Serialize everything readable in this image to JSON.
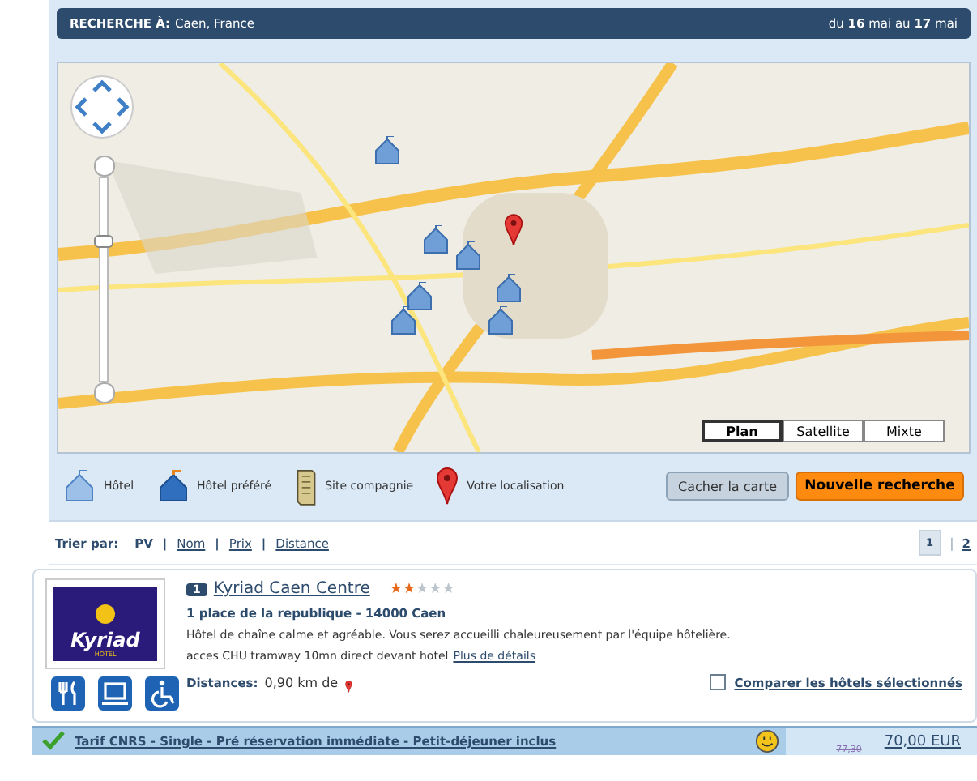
{
  "search_header": {
    "label": "RECHERCHE À:",
    "place": "Caen, France",
    "dates": "du **16** mai au **17** mai"
  },
  "map": {
    "zoom": {
      "level": 0.7
    },
    "map_types": [
      {
        "label": "Plan",
        "selected": true
      },
      {
        "label": "Satellite",
        "selected": false
      },
      {
        "label": "Mixte",
        "selected": false
      }
    ]
  },
  "legend": [
    {
      "kind": "hotel",
      "label": "Hôtel"
    },
    {
      "kind": "preferred",
      "label": "Hôtel préféré"
    },
    {
      "kind": "company",
      "label": "Site compagnie"
    },
    {
      "kind": "location",
      "label": "Votre localisation"
    }
  ],
  "buttons": {
    "hide_map": "Cacher la carte",
    "new_search": "Nouvelle recherche"
  },
  "sort": {
    "label": "Trier par:",
    "separator": "|",
    "options": [
      {
        "label": "PV",
        "selected": true
      },
      {
        "label": "Nom",
        "selected": false
      },
      {
        "label": "Prix",
        "selected": false
      },
      {
        "label": "Distance",
        "selected": false
      }
    ]
  },
  "pager": {
    "separator": "|",
    "pages": [
      {
        "label": "1",
        "selected": true
      },
      {
        "label": "2",
        "selected": false
      }
    ]
  },
  "hotel": {
    "logo": "Kyriad",
    "logo_sub": "HOTEL",
    "number": "1",
    "name": "Kyriad Caen Centre",
    "stars": 2,
    "address": "1 place de la republique - 14000 Caen",
    "description": "Hôtel de chaîne calme et agréable. Vous serez accueilli chaleureusement par l'équipe hôtelière.",
    "access": "acces CHU tramway 10mn direct devant hotel",
    "details_link": "Plus de détails",
    "distance_label": "Distances:",
    "distance": "0,90 km de",
    "compare": {
      "label": "Comparer les hôtels sélectionnés",
      "checked": false
    },
    "rate": {
      "name": "Tarif CNRS - Single - Pré réservation immédiate - Petit-déjeuner inclus",
      "old_price": "77,30",
      "price": "70,00 EUR"
    }
  }
}
